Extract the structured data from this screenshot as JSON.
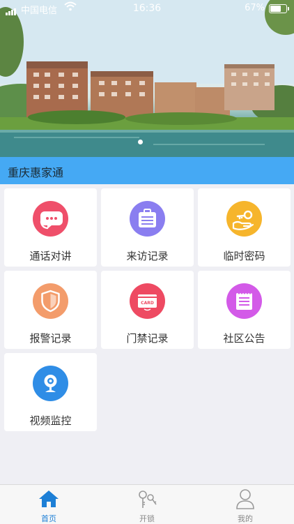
{
  "status_bar": {
    "carrier": "中国电信",
    "time": "16:36",
    "battery": "67%"
  },
  "banner": {
    "active_slide": 1,
    "slide_count": 1
  },
  "community": {
    "name": "重庆惠家通"
  },
  "colors": {
    "title_bar": "#45a9f4",
    "tab_active": "#1d7fd6"
  },
  "features": [
    {
      "label": "通话对讲",
      "icon": "chat-bubble-icon",
      "color": "#ef4f6a"
    },
    {
      "label": "来访记录",
      "icon": "briefcase-list-icon",
      "color": "#8a7ef0"
    },
    {
      "label": "临时密码",
      "icon": "key-hand-icon",
      "color": "#f6b52c"
    },
    {
      "label": "报警记录",
      "icon": "shield-icon",
      "color": "#f39c6b"
    },
    {
      "label": "门禁记录",
      "icon": "access-card-icon",
      "color": "#ee4a62"
    },
    {
      "label": "社区公告",
      "icon": "notice-board-icon",
      "color": "#d35ae8"
    },
    {
      "label": "视频监控",
      "icon": "webcam-icon",
      "color": "#2f8de6"
    }
  ],
  "tabs": [
    {
      "label": "首页",
      "icon": "home-icon",
      "active": true
    },
    {
      "label": "开锁",
      "icon": "keys-icon",
      "active": false
    },
    {
      "label": "我的",
      "icon": "user-icon",
      "active": false
    }
  ]
}
